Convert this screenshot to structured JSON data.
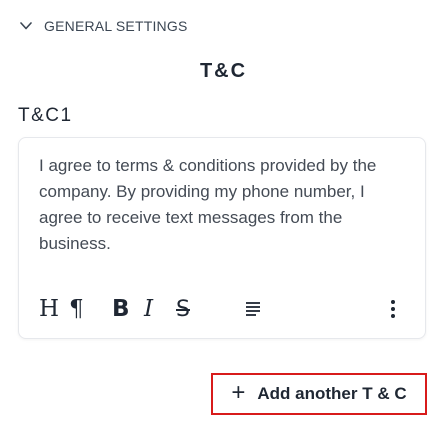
{
  "section": {
    "title": "GENERAL SETTINGS",
    "expand_icon": "chevron-down-icon"
  },
  "page_title": "T&C",
  "items": [
    {
      "label": "T&C1",
      "text": "I agree to terms & conditions provided by the company. By providing my phone number, I agree to receive text messages from the business."
    }
  ],
  "toolbar": {
    "heading": "H",
    "paragraph": "¶",
    "bold": "B",
    "italic": "I",
    "strikethrough": "S",
    "align_icon": "align-left-icon",
    "more_icon": "more-vertical-icon"
  },
  "add_button": {
    "icon": "plus-icon",
    "label": "Add another T & C",
    "highlight_color": "#d81b1b"
  }
}
